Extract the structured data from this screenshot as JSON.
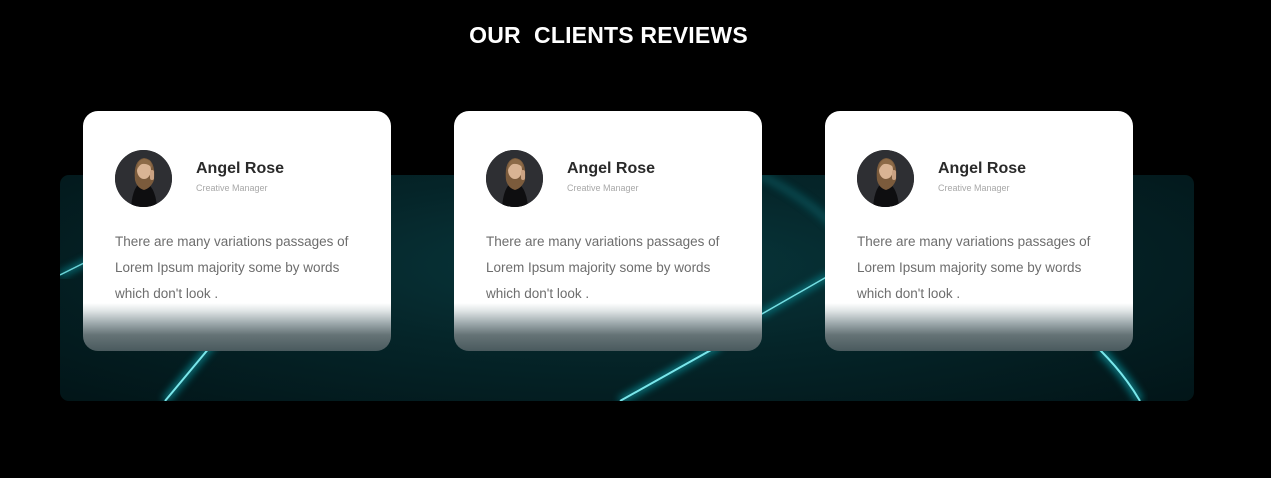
{
  "section": {
    "title": "OUR  CLIENTS REVIEWS"
  },
  "colors": {
    "page_background": "#000000",
    "card_background": "#ffffff",
    "accent_glow": "#14d6e0",
    "name_text": "#2a2a2a",
    "body_text": "#6d6d6d"
  },
  "reviews": [
    {
      "avatar_icon": "user-photo-avatar",
      "name": "Angel Rose",
      "role": "Creative Manager",
      "text": "There are many variations passages of Lorem Ipsum majority some by words which don't look ."
    },
    {
      "avatar_icon": "user-photo-avatar",
      "name": "Angel Rose",
      "role": "Creative Manager",
      "text": "There are many variations passages of Lorem Ipsum majority some by words which don't look ."
    },
    {
      "avatar_icon": "user-photo-avatar",
      "name": "Angel Rose",
      "role": "Creative Manager",
      "text": "There are many variations passages of Lorem Ipsum majority some by words which don't look ."
    }
  ]
}
